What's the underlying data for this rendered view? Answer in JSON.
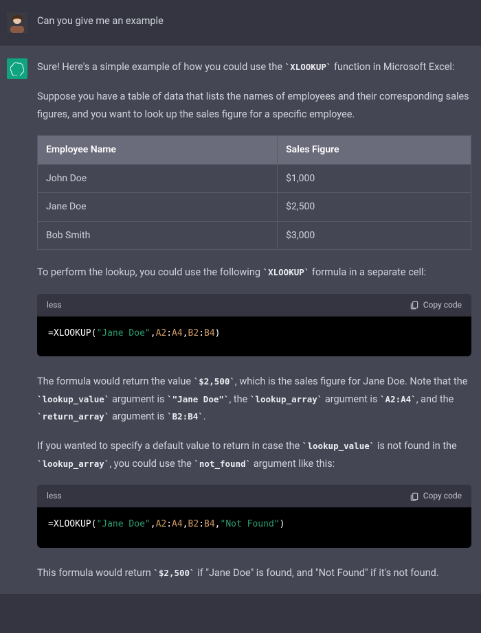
{
  "user": {
    "prompt": "Can you give me an example"
  },
  "assistant": {
    "p1_a": "Sure! Here's a simple example of how you could use the ",
    "p1_code": "`XLOOKUP`",
    "p1_b": " function in Microsoft Excel:",
    "p2": "Suppose you have a table of data that lists the names of employees and their corresponding sales figures, and you want to look up the sales figure for a specific employee.",
    "table": {
      "headers": [
        "Employee Name",
        "Sales Figure"
      ],
      "rows": [
        [
          "John Doe",
          "$1,000"
        ],
        [
          "Jane Doe",
          "$2,500"
        ],
        [
          "Bob Smith",
          "$3,000"
        ]
      ]
    },
    "p3_a": "To perform the lookup, you could use the following ",
    "p3_code": "`XLOOKUP`",
    "p3_b": " formula in a separate cell:",
    "code1": {
      "lang": "less",
      "copy": "Copy code",
      "tokens": {
        "eq": "=",
        "fn": "XLOOKUP",
        "op": "(",
        "s1": "\"Jane Doe\"",
        "c1": ",",
        "r1": "A2",
        "colon1": ":",
        "r2": "A4",
        "c2": ",",
        "r3": "B2",
        "colon2": ":",
        "r4": "B4",
        "cp": ")"
      }
    },
    "p4_a": "The formula would return the value ",
    "p4_code1": "`$2,500`",
    "p4_b": ", which is the sales figure for Jane Doe. Note that the ",
    "p4_code2": "`lookup_value`",
    "p4_c": " argument is ",
    "p4_code3": "`\"Jane Doe\"`",
    "p4_d": ", the ",
    "p4_code4": "`lookup_array`",
    "p4_e": " argument is ",
    "p4_code5": "`A2:A4`",
    "p4_f": ", and the ",
    "p4_code6": "`return_array`",
    "p4_g": " argument is ",
    "p4_code7": "`B2:B4`",
    "p4_h": ".",
    "p5_a": "If you wanted to specify a default value to return in case the ",
    "p5_code1": "`lookup_value`",
    "p5_b": " is not found in the ",
    "p5_code2": "`lookup_array`",
    "p5_c": ", you could use the ",
    "p5_code3": "`not_found`",
    "p5_d": " argument like this:",
    "code2": {
      "lang": "less",
      "copy": "Copy code",
      "tokens": {
        "eq": "=",
        "fn": "XLOOKUP",
        "op": "(",
        "s1": "\"Jane Doe\"",
        "c1": ",",
        "r1": "A2",
        "colon1": ":",
        "r2": "A4",
        "c2": ",",
        "r3": "B2",
        "colon2": ":",
        "r4": "B4",
        "c3": ",",
        "s2": "\"Not Found\"",
        "cp": ")"
      }
    },
    "p6_a": "This formula would return ",
    "p6_code1": "`$2,500`",
    "p6_b": " if \"Jane Doe\" is found, and \"Not Found\" if it's not found."
  }
}
